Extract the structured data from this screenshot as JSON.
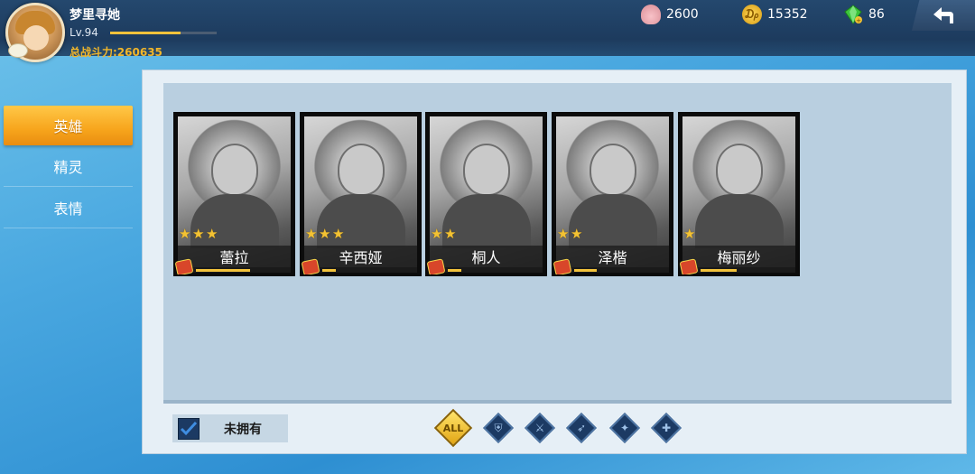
{
  "player": {
    "name": "梦里寻她",
    "level": "Lv.94",
    "exp_fraction": 0.66,
    "power": "总战斗力:260635"
  },
  "resources": {
    "shells": "2600",
    "coins": "15352",
    "gems": "86"
  },
  "sidebar": {
    "items": [
      {
        "label": "英雄",
        "active": true
      },
      {
        "label": "精灵",
        "active": false
      },
      {
        "label": "表情",
        "active": false
      }
    ]
  },
  "heroes": [
    {
      "name": "蕾拉",
      "stars": 3,
      "shard_progress": 0.6
    },
    {
      "name": "辛西娅",
      "stars": 3,
      "shard_progress": 0.15
    },
    {
      "name": "桐人",
      "stars": 2,
      "shard_progress": 0.15
    },
    {
      "name": "泽楷",
      "stars": 2,
      "shard_progress": 0.25
    },
    {
      "name": "梅丽纱",
      "stars": 1,
      "shard_progress": 0.4
    }
  ],
  "filters": {
    "owned_label": "未拥有",
    "owned_checked": true,
    "classes": [
      {
        "label": "ALL",
        "icon": "all-icon",
        "active": true
      },
      {
        "label": "",
        "icon": "shield-class-icon",
        "active": false
      },
      {
        "label": "",
        "icon": "warrior-class-icon",
        "active": false
      },
      {
        "label": "",
        "icon": "archer-class-icon",
        "active": false
      },
      {
        "label": "",
        "icon": "mage-class-icon",
        "active": false
      },
      {
        "label": "",
        "icon": "support-class-icon",
        "active": false
      }
    ]
  },
  "colors": {
    "accent": "#f7a51c",
    "gold_text": "#f2b62a",
    "star": "#f3c233",
    "panel": "#e6eff6",
    "grid_bg": "#b9cfe0"
  }
}
